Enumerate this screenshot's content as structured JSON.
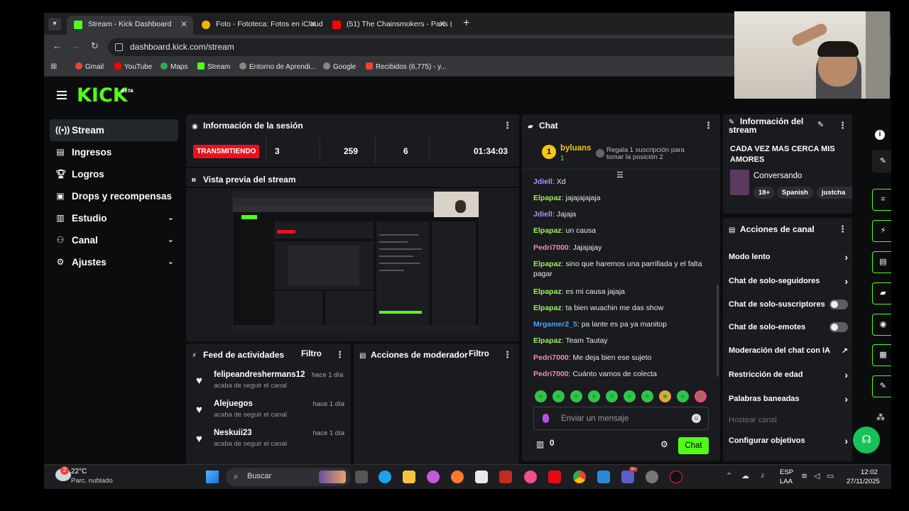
{
  "browser": {
    "tabs": [
      {
        "title": "Stream - Kick Dashboard",
        "favicon_color": "#53fc18",
        "active": true
      },
      {
        "title": "Foto - Fototeca: Fotos en iCloud",
        "favicon_color": "#f4b400",
        "active": false
      },
      {
        "title": "(51) The Chainsmokers - Paris (",
        "favicon_color": "#ff0000",
        "active": false
      }
    ],
    "url": "dashboard.kick.com/stream",
    "bookmarks": [
      "Gmail",
      "YouTube",
      "Maps",
      "Stream",
      "Entorno de Aprendi...",
      "Google",
      "Recibidos (6,775) - y..."
    ]
  },
  "app": {
    "logo": "KICK",
    "logo_badge": "BETA",
    "sidebar": [
      {
        "label": "Stream",
        "icon": "broadcast-icon",
        "active": true,
        "chevron": false
      },
      {
        "label": "Ingresos",
        "icon": "chart-icon",
        "active": false,
        "chevron": false
      },
      {
        "label": "Logros",
        "icon": "trophy-icon",
        "active": false,
        "chevron": false
      },
      {
        "label": "Drops y recompensas",
        "icon": "gift-icon",
        "active": false,
        "chevron": false
      },
      {
        "label": "Estudio",
        "icon": "studio-icon",
        "active": false,
        "chevron": true
      },
      {
        "label": "Canal",
        "icon": "channel-icon",
        "active": false,
        "chevron": true
      },
      {
        "label": "Ajustes",
        "icon": "gear-icon",
        "active": false,
        "chevron": true
      }
    ],
    "session": {
      "title": "Información de la sesión",
      "live_label": "TRANSMITIENDO",
      "stats": [
        "3",
        "259",
        "6",
        "01:34:03"
      ]
    },
    "preview": {
      "title": "Vista previa del stream"
    },
    "feed": {
      "title": "Feed de actividades",
      "filter": "Filtro",
      "items": [
        {
          "user": "felipeandreshermans12",
          "time": "hace 1 día",
          "action": "acaba de seguir el canal"
        },
        {
          "user": "Alejuegos",
          "time": "hace 1 día",
          "action": "acaba de seguir el canal"
        },
        {
          "user": "Neskuii23",
          "time": "hace 1 día",
          "action": "acaba de seguir el canal"
        }
      ]
    },
    "moderator": {
      "title": "Acciones de moderador",
      "filter": "Filtro"
    },
    "chat": {
      "title": "Chat",
      "top_user": "byluans",
      "top_rank": "1",
      "top_count": "1",
      "gift_text": "Regala 1 suscripción para tomar la posición 2",
      "messages": [
        {
          "user": "Jdiell",
          "text": "Xd",
          "color": "#b98cff"
        },
        {
          "user": "Elpapaz",
          "text": "jajajajajaja",
          "color": "#9ef05b"
        },
        {
          "user": "Jdiell",
          "text": "Jajaja",
          "color": "#b98cff"
        },
        {
          "user": "Elpapaz",
          "text": "un causa",
          "color": "#9ef05b"
        },
        {
          "user": "Pedri7000",
          "text": "Jajajajay",
          "color": "#ff85b3"
        },
        {
          "user": "Elpapaz",
          "text": "sino que haremos una parrillada y el falta pagar",
          "color": "#9ef05b"
        },
        {
          "user": "Elpapaz",
          "text": "es mi causa jajaja",
          "color": "#9ef05b"
        },
        {
          "user": "Elpapaz",
          "text": "ta bien wuachin me das show",
          "color": "#9ef05b"
        },
        {
          "user": "Mrgamer2_5",
          "text": "pa lante es pa ya manitop",
          "color": "#4da3ff"
        },
        {
          "user": "Elpapaz",
          "text": "Team Tautay",
          "color": "#9ef05b"
        },
        {
          "user": "Pedri7000",
          "text": "Me deja bien ese sujeto",
          "color": "#ff85b3"
        },
        {
          "user": "Pedri7000",
          "text": "Cuánto vamos de colecta",
          "color": "#ff85b3"
        }
      ],
      "input_placeholder": "Enviar un mensaje",
      "points": "0",
      "send_label": "Chat"
    },
    "stream_info": {
      "title": "Información del stream",
      "stream_title": "CADA VEZ MAS CERCA MIS AMORES",
      "category": "Conversando",
      "tags": [
        "18+",
        "Spanish",
        "justcha"
      ]
    },
    "channel_actions": {
      "title": "Acciones de canal",
      "items": [
        {
          "label": "Modo lento",
          "control": "arrow"
        },
        {
          "label": "Chat de solo-seguidores",
          "control": "arrow"
        },
        {
          "label": "Chat de solo-suscriptores",
          "control": "toggle"
        },
        {
          "label": "Chat de solo-emotes",
          "control": "toggle"
        },
        {
          "label": "Moderación del chat con IA",
          "control": "external"
        },
        {
          "label": "Restricción de edad",
          "control": "arrow"
        },
        {
          "label": "Palabras baneadas",
          "control": "arrow"
        },
        {
          "label": "Hostear canal",
          "control": "none"
        },
        {
          "label": "Configurar objetivos",
          "control": "arrow"
        }
      ]
    },
    "right_rail": [
      "info-icon",
      "pencil-icon",
      "scan-icon",
      "bolt-icon",
      "document-icon",
      "chat-bubble-icon",
      "broadcast-icon",
      "layout-icon",
      "wrench-icon"
    ]
  },
  "taskbar": {
    "weather_temp": "22°C",
    "weather_desc": "Parc. nublado",
    "weather_badge": "2",
    "search": "Buscar",
    "lang": "ESP",
    "region": "LAA",
    "time": "12:02",
    "date": "27/11/2025",
    "teams_badge": "9+"
  },
  "colors": {
    "accent": "#53fc18",
    "live": "#e9111d",
    "panel": "#191b1f",
    "bg": "#0b0c0d"
  }
}
